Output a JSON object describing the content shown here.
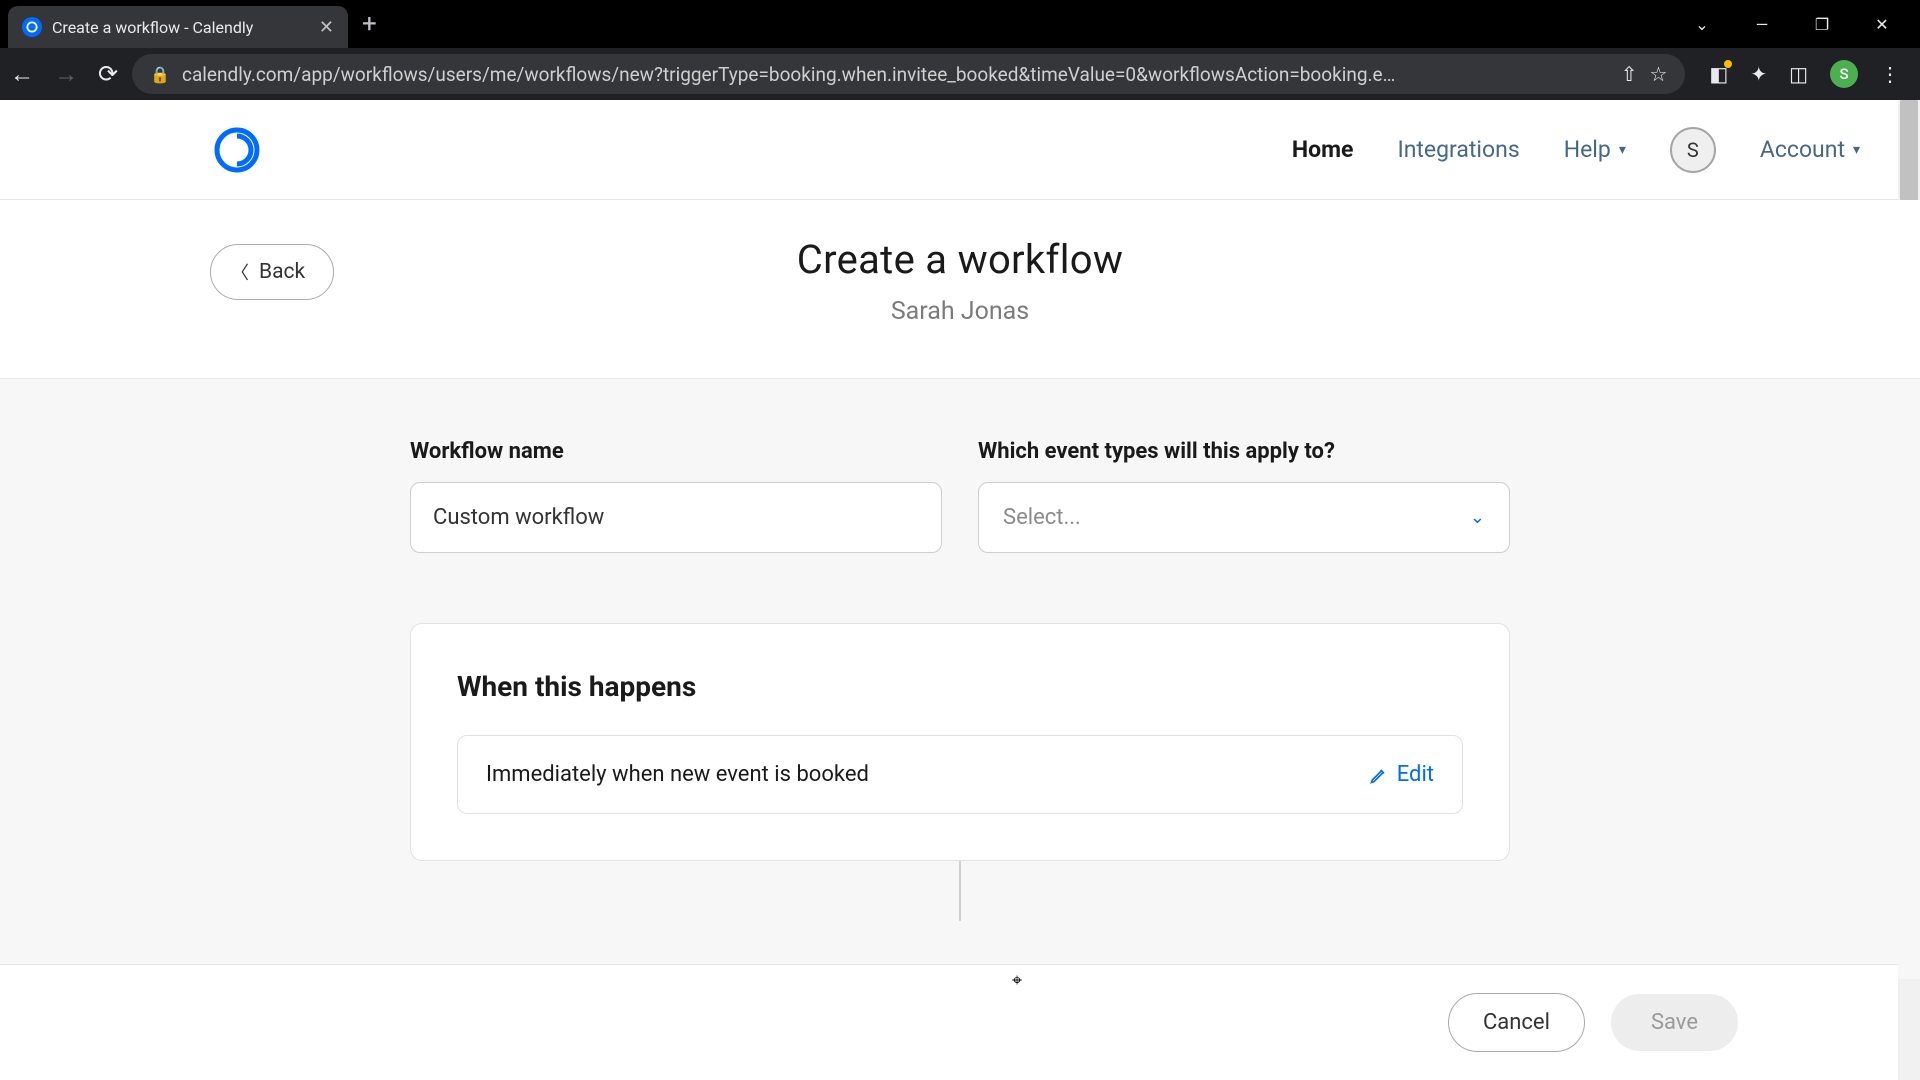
{
  "browser": {
    "tab_title": "Create a workflow - Calendly",
    "url": "calendly.com/app/workflows/users/me/workflows/new?triggerType=booking.when.invitee_booked&timeValue=0&workflowsAction=booking.e…",
    "profile_initial": "S"
  },
  "header": {
    "nav": {
      "home": "Home",
      "integrations": "Integrations",
      "help": "Help",
      "account": "Account"
    },
    "avatar_initial": "S"
  },
  "page": {
    "back_label": "Back",
    "title": "Create a workflow",
    "subtitle": "Sarah Jonas"
  },
  "form": {
    "name_label": "Workflow name",
    "name_value": "Custom workflow",
    "event_types_label": "Which event types will this apply to?",
    "event_types_placeholder": "Select..."
  },
  "trigger": {
    "heading": "When this happens",
    "text": "Immediately when new event is booked",
    "edit_label": "Edit"
  },
  "footer": {
    "cancel": "Cancel",
    "save": "Save"
  }
}
